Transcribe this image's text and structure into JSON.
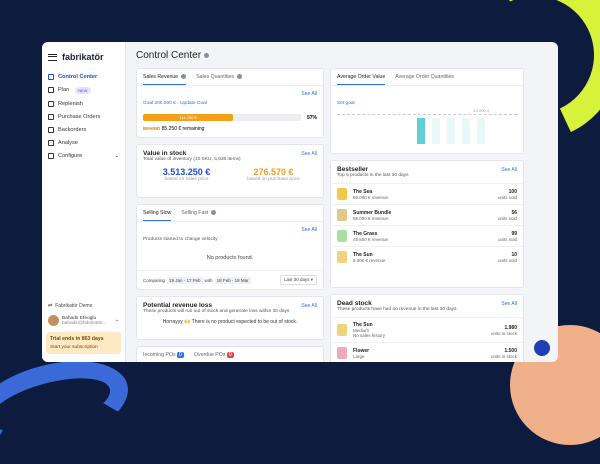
{
  "app": {
    "logo": "fabrikatör",
    "page_title": "Control Center"
  },
  "sidebar": {
    "items": [
      {
        "label": "Control Center",
        "active": true
      },
      {
        "label": "Plan",
        "badge": "NEW"
      },
      {
        "label": "Replenish"
      },
      {
        "label": "Purchase Orders"
      },
      {
        "label": "Backorders"
      },
      {
        "label": "Analyse"
      },
      {
        "label": "Configure"
      }
    ],
    "demo": "Fabrikatör Demo",
    "user_name": "Bahadir Efeoglu",
    "user_email": "bahadir@fabrikatör...",
    "trial": "Trial ends in 863 days",
    "trial_cta": "Start your subscription"
  },
  "sales": {
    "tab1": "Sales Revenue",
    "tab2": "Sales Quantities",
    "goal": "Goal 200.000 € · Update Goal",
    "see_all": "See All",
    "bar_label": "114.750 €",
    "progress_text": "57%",
    "progress": 0.57,
    "status": "BEHIND",
    "remaining": "85.250 € remaining"
  },
  "aov": {
    "tab1": "Average Order Value",
    "tab2": "Average Order Quantities",
    "set_goal": "Set goal",
    "value_label": "£4,000.4"
  },
  "stock": {
    "title": "Value in stock",
    "subtitle": "Total value of inventory (10 SKU, 5,636 items)",
    "see_all": "See All",
    "v1": "3.513.250 €",
    "l1": "based on sales price",
    "v2": "276.570 €",
    "l2": "based on purchase price"
  },
  "slow": {
    "tab1": "Selling Slow",
    "tab2": "Selling Fast",
    "desc": "Products started to change velocity",
    "see_all": "See All",
    "empty": "No products found.",
    "compare_a": "Comparing",
    "compare_b": "19 Jan - 17 Feb",
    "compare_c": "with",
    "compare_d": "18 Feb - 18 Mar",
    "range": "Last 30 days ▾"
  },
  "loss": {
    "title": "Potential revenue loss",
    "desc": "These products will run out of stock and generate loss within 30 days",
    "see_all": "See All",
    "msg": "Horrayyy 🙌 There is no product expected to be out of stock."
  },
  "incoming": {
    "t1": "Incoming POs",
    "c1": "0",
    "t2": "Overdue POs",
    "c2": "0"
  },
  "best": {
    "title": "Bestseller",
    "desc": "Top 5 products in the last 30 days",
    "see_all": "See All",
    "products": [
      {
        "name": "The Sea",
        "rev": "65.000 € revenue",
        "units": "100",
        "u": "units sold",
        "color": "#f0c84a"
      },
      {
        "name": "Summer Bundle",
        "rev": "56.000 € revenue",
        "units": "56",
        "u": "units sold",
        "color": "#e2c88a"
      },
      {
        "name": "The Grass",
        "rev": "49.500 € revenue",
        "units": "99",
        "u": "units sold",
        "color": "#a8e0a0"
      },
      {
        "name": "The Sun",
        "rev": "8.000 € revenue",
        "units": "10",
        "u": "units sold",
        "color": "#f2d27a"
      }
    ]
  },
  "dead": {
    "title": "Dead stock",
    "desc": "These products have had no revenue in the last 30 days",
    "see_all": "See All",
    "products": [
      {
        "name": "The Sun",
        "sub": "Medium",
        "sub2": "No sales history",
        "units": "1.980",
        "u": "units in stock",
        "color": "#f2d27a"
      },
      {
        "name": "Flower",
        "sub": "Large",
        "units": "1.500",
        "u": "units in stock",
        "color": "#f0a8b8"
      }
    ]
  }
}
